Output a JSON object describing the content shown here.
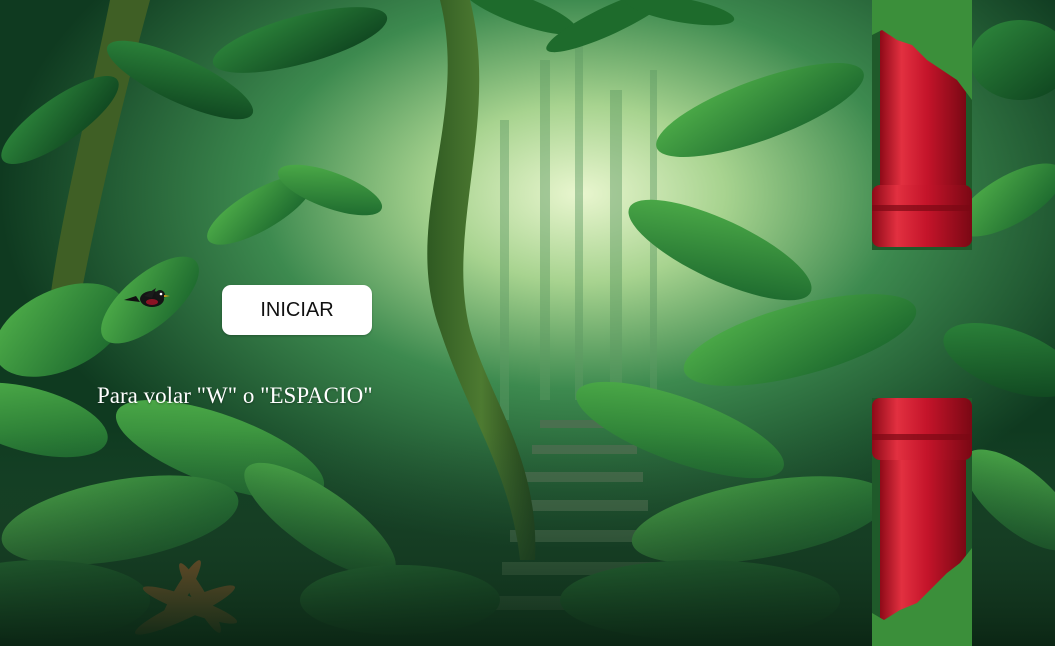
{
  "game": {
    "start_button_label": "INICIAR",
    "instructions": "Para volar \"W\" o \"ESPACIO\""
  },
  "sprites": {
    "player": "bird-icon",
    "obstacle": "red-pipe"
  },
  "colors": {
    "pipe_red": "#d0162a",
    "pipe_dark": "#8e0a18",
    "jungle_green": "#1f6a35",
    "button_bg": "#ffffff",
    "text": "#ffffff"
  }
}
